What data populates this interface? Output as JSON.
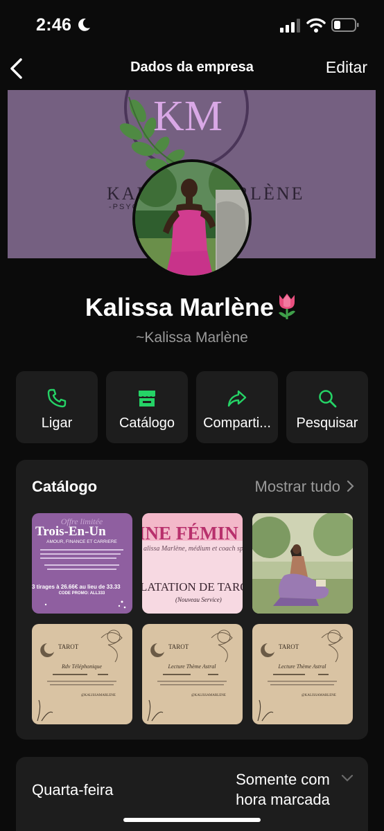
{
  "status_bar": {
    "time": "2:46"
  },
  "nav": {
    "title": "Dados da empresa",
    "edit_label": "Editar"
  },
  "cover": {
    "monogram": "KM",
    "brand_text": "KALISSA MARLÈNE",
    "subtitle": "-PSYCHIC · SPIRITUAL"
  },
  "profile": {
    "name": "Kalissa Marlène",
    "handle": "~Kalissa Marlène"
  },
  "actions": [
    {
      "label": "Ligar",
      "icon": "phone-icon"
    },
    {
      "label": "Catálogo",
      "icon": "storefront-icon"
    },
    {
      "label": "Comparti...",
      "icon": "share-icon"
    },
    {
      "label": "Pesquisar",
      "icon": "search-icon"
    }
  ],
  "catalog": {
    "title": "Catálogo",
    "show_all_label": "Mostrar tudo",
    "items": [
      {
        "headline": "Trois-En-Un",
        "overline": "Offre limitée",
        "sub": "AMOUR, FINANCE ET CARRIERE",
        "footer": "3 tirages à 26.66€ au lieu de 33.33",
        "promo": "CODE PROMO: ALL333"
      },
      {
        "headline": "INE FÉMIN",
        "sub": "alissa Marlène, médium et coach spi",
        "footer": "LATATION DE TARO",
        "promo": "(Nouveau Service)"
      },
      {
        "headline": ""
      },
      {
        "headline": "TAROT",
        "sub": "Rdv Téléphonique",
        "footer": "@KALISSAMARLENE"
      },
      {
        "headline": "TAROT",
        "sub": "Lecture Thème Astral",
        "footer": "@KALISSAMARLENE"
      },
      {
        "headline": "TAROT",
        "sub": "Lecture Thème Astral",
        "footer": "@KALISSAMARLENE"
      }
    ]
  },
  "hours": {
    "day": "Quarta-feira",
    "status_line1": "Somente com",
    "status_line2": "hora marcada"
  },
  "colors": {
    "accent_green": "#25d366",
    "background": "#0b0b0b",
    "card": "#1d1d1d",
    "muted_text": "#9a9a9a",
    "cover_purple": "#756081"
  }
}
